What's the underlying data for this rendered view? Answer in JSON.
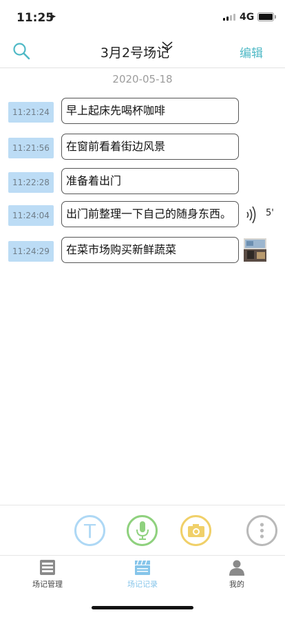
{
  "status_bar": {
    "time": "11:25",
    "network": "4G"
  },
  "nav": {
    "title": "3月2号场记",
    "edit_label": "编辑"
  },
  "date": "2020-05-18",
  "entries": [
    {
      "time": "11:21:24",
      "text": "早上起床先喝杯咖啡"
    },
    {
      "time": "11:21:56",
      "text": "在窗前看着街边风景"
    },
    {
      "time": "11:22:28",
      "text": "准备着出门"
    },
    {
      "time": "11:24:04",
      "text": "出门前整理一下自己的随身东西。",
      "voice_duration": "5'"
    },
    {
      "time": "11:24:29",
      "text": "在菜市场购买新鲜蔬菜",
      "attachment": "photo-thumbnail"
    }
  ],
  "toolbar": {
    "text_button_label": "T"
  },
  "tabs": [
    {
      "label": "场记管理",
      "icon": "list-box-icon"
    },
    {
      "label": "场记记录",
      "icon": "clapperboard-icon",
      "active": true
    },
    {
      "label": "我的",
      "icon": "person-icon"
    }
  ],
  "colors": {
    "accent": "#4fb9c6",
    "timestamp_bg": "#bcdcf5",
    "mic": "#8fd17e",
    "camera": "#f0d069",
    "text_tool": "#aed8f5"
  }
}
